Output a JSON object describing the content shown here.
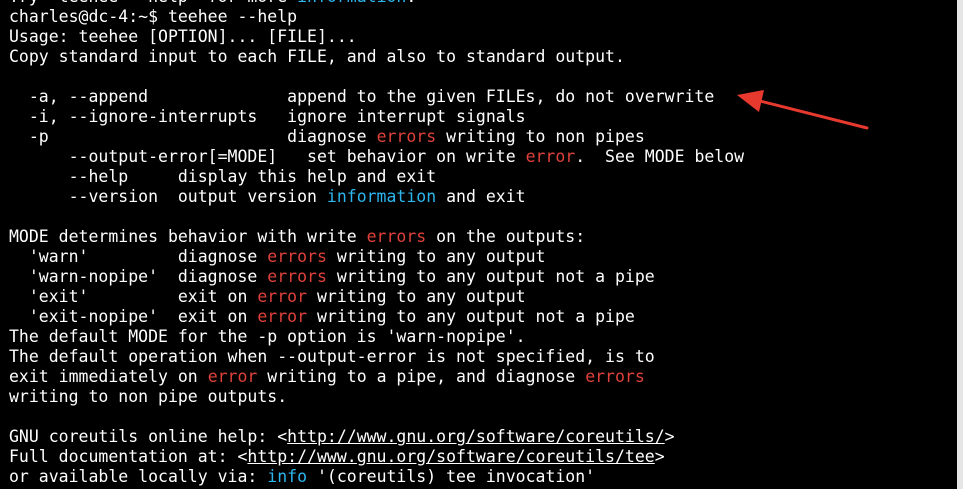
{
  "colors": {
    "background": "#000000",
    "text": "#ffffff",
    "error_keyword": "#e0413b",
    "information_keyword": "#2cb6ee",
    "annotation_arrow": "#e8392f"
  },
  "annotation": {
    "type": "arrow",
    "color": "#e8392f",
    "points_to": "append option line"
  },
  "lines": [
    {
      "kind": "output",
      "segments": [
        {
          "text": "Try 'teehee --help' for more "
        },
        {
          "text": "information",
          "style": "cyan"
        },
        {
          "text": "."
        }
      ]
    },
    {
      "kind": "prompt",
      "segments": [
        {
          "text": "charles@dc-4:~$ teehee --help"
        }
      ]
    },
    {
      "kind": "output",
      "segments": [
        {
          "text": "Usage: teehee [OPTION]... [FILE]..."
        }
      ]
    },
    {
      "kind": "output",
      "segments": [
        {
          "text": "Copy standard input to each FILE, and also to standard output."
        }
      ]
    },
    {
      "kind": "blank",
      "segments": [
        {
          "text": ""
        }
      ]
    },
    {
      "kind": "output",
      "segments": [
        {
          "text": "  -a, --append              append to the given FILEs, do not overwrite"
        }
      ]
    },
    {
      "kind": "output",
      "segments": [
        {
          "text": "  -i, --ignore-interrupts   ignore interrupt signals"
        }
      ]
    },
    {
      "kind": "output",
      "segments": [
        {
          "text": "  -p                        diagnose "
        },
        {
          "text": "errors",
          "style": "red"
        },
        {
          "text": " writing to non pipes"
        }
      ]
    },
    {
      "kind": "output",
      "segments": [
        {
          "text": "      --output-error[=MODE]   set behavior on write "
        },
        {
          "text": "error",
          "style": "red"
        },
        {
          "text": ".  See MODE below"
        }
      ]
    },
    {
      "kind": "output",
      "segments": [
        {
          "text": "      --help     display this help and exit"
        }
      ]
    },
    {
      "kind": "output",
      "segments": [
        {
          "text": "      --version  output version "
        },
        {
          "text": "information",
          "style": "cyan"
        },
        {
          "text": " and exit"
        }
      ]
    },
    {
      "kind": "blank",
      "segments": [
        {
          "text": ""
        }
      ]
    },
    {
      "kind": "output",
      "segments": [
        {
          "text": "MODE determines behavior with write "
        },
        {
          "text": "errors",
          "style": "red"
        },
        {
          "text": " on the outputs:"
        }
      ]
    },
    {
      "kind": "output",
      "segments": [
        {
          "text": "  'warn'         diagnose "
        },
        {
          "text": "errors",
          "style": "red"
        },
        {
          "text": " writing to any output"
        }
      ]
    },
    {
      "kind": "output",
      "segments": [
        {
          "text": "  'warn-nopipe'  diagnose "
        },
        {
          "text": "errors",
          "style": "red"
        },
        {
          "text": " writing to any output not a pipe"
        }
      ]
    },
    {
      "kind": "output",
      "segments": [
        {
          "text": "  'exit'         exit on "
        },
        {
          "text": "error",
          "style": "red"
        },
        {
          "text": " writing to any output"
        }
      ]
    },
    {
      "kind": "output",
      "segments": [
        {
          "text": "  'exit-nopipe'  exit on "
        },
        {
          "text": "error",
          "style": "red"
        },
        {
          "text": " writing to any output not a pipe"
        }
      ]
    },
    {
      "kind": "output",
      "segments": [
        {
          "text": "The default MODE for the -p option is 'warn-nopipe'."
        }
      ]
    },
    {
      "kind": "output",
      "segments": [
        {
          "text": "The default operation when --output-error is not specified, is to"
        }
      ]
    },
    {
      "kind": "output",
      "segments": [
        {
          "text": "exit immediately on "
        },
        {
          "text": "error",
          "style": "red"
        },
        {
          "text": " writing to a pipe, and diagnose "
        },
        {
          "text": "errors",
          "style": "red"
        }
      ]
    },
    {
      "kind": "output",
      "segments": [
        {
          "text": "writing to non pipe outputs."
        }
      ]
    },
    {
      "kind": "blank",
      "segments": [
        {
          "text": ""
        }
      ]
    },
    {
      "kind": "output",
      "segments": [
        {
          "text": "GNU coreutils online help: <"
        },
        {
          "text": "http://www.gnu.org/software/coreutils/",
          "style": "url"
        },
        {
          "text": ">"
        }
      ]
    },
    {
      "kind": "output",
      "segments": [
        {
          "text": "Full documentation at: <"
        },
        {
          "text": "http://www.gnu.org/software/coreutils/tee",
          "style": "url"
        },
        {
          "text": ">"
        }
      ]
    },
    {
      "kind": "output",
      "segments": [
        {
          "text": "or available locally via: "
        },
        {
          "text": "info",
          "style": "cyan"
        },
        {
          "text": " '(coreutils) tee invocation'"
        }
      ]
    }
  ]
}
